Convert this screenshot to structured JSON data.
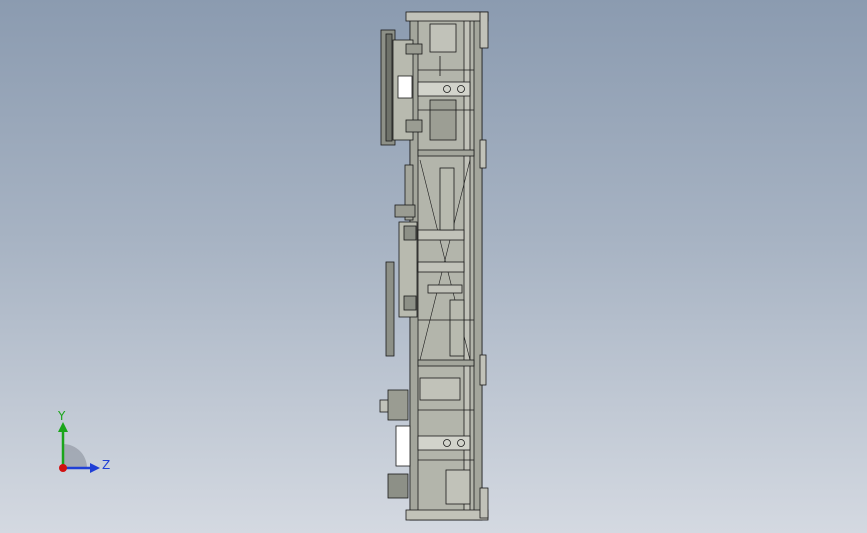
{
  "viewport": {
    "background_top": "#8b9bb0",
    "background_bottom": "#d4d9e1",
    "model_stroke": "#1a1a1a",
    "model_fill": "#a4a69c",
    "model_fill_light": "#c1c2b9"
  },
  "triad": {
    "y_label": "Y",
    "z_label": "Z",
    "y_color": "#1aa51a",
    "z_color": "#1f3fd6",
    "x_color": "#d01010"
  }
}
